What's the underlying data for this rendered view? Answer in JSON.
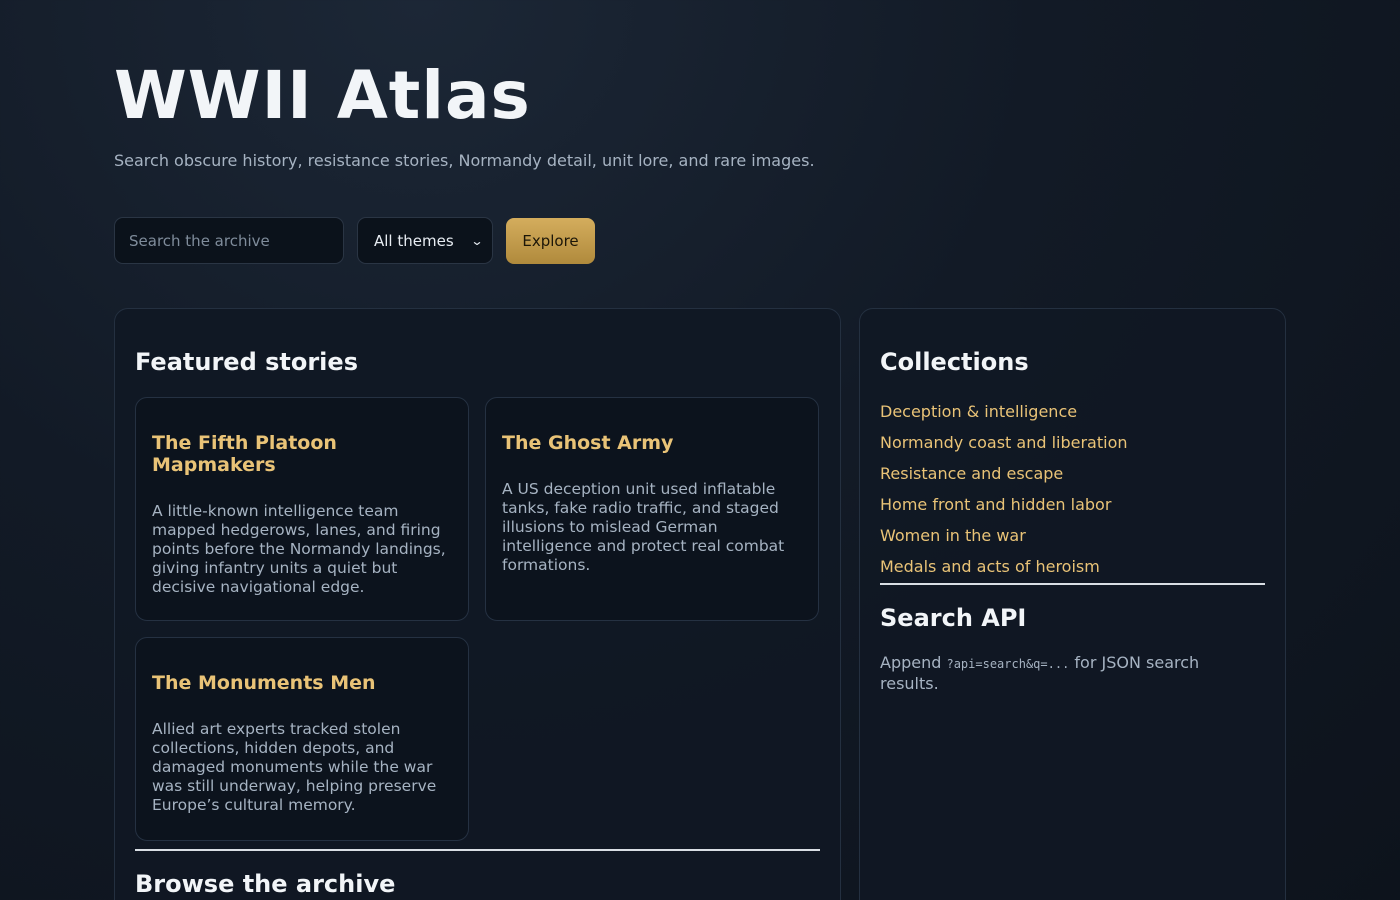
{
  "header": {
    "title": "WWII Atlas",
    "tagline": "Search obscure history, resistance stories, Normandy detail, unit lore, and rare images."
  },
  "search": {
    "placeholder": "Search the archive",
    "value": "",
    "theme_selected": "All themes",
    "explore_label": "Explore"
  },
  "featured": {
    "heading": "Featured stories",
    "stories": [
      {
        "title": "The Fifth Platoon Mapmakers",
        "body": "A little-known intelligence team mapped hedgerows, lanes, and firing points before the Normandy landings, giving infantry units a quiet but decisive navigational edge."
      },
      {
        "title": "The Ghost Army",
        "body": "A US deception unit used inflatable tanks, fake radio traffic, and staged illusions to mislead German intelligence and protect real combat formations."
      },
      {
        "title": "The Monuments Men",
        "body": "Allied art experts tracked stolen collections, hidden depots, and damaged monuments while the war was still underway, helping preserve Europe’s cultural memory."
      }
    ]
  },
  "browse": {
    "heading": "Browse the archive"
  },
  "collections": {
    "heading": "Collections",
    "items": [
      "Deception & intelligence",
      "Normandy coast and liberation",
      "Resistance and escape",
      "Home front and hidden labor",
      "Women in the war",
      "Medals and acts of heroism"
    ]
  },
  "api": {
    "heading": "Search API",
    "prefix": "Append ",
    "code": "?api=search&q=...",
    "suffix": " for JSON search results."
  },
  "colors": {
    "accent_gold": "#e9c377",
    "button_gold": "#c9a24e",
    "background": "#121a26"
  }
}
